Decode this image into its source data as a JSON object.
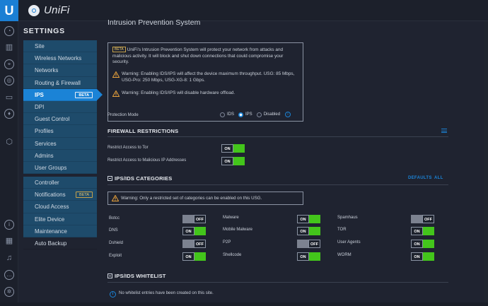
{
  "app": {
    "brand": "UniFi",
    "logo_letter": "U"
  },
  "sidebar": {
    "title": "SETTINGS",
    "group1": [
      {
        "label": "Site"
      },
      {
        "label": "Wireless Networks"
      },
      {
        "label": "Networks"
      },
      {
        "label": "Routing & Firewall"
      },
      {
        "label": "IPS",
        "active": true,
        "badge": "BETA"
      },
      {
        "label": "DPI"
      },
      {
        "label": "Guest Control"
      },
      {
        "label": "Profiles"
      },
      {
        "label": "Services"
      },
      {
        "label": "Admins"
      },
      {
        "label": "User Groups"
      }
    ],
    "group2": [
      {
        "label": "Controller"
      },
      {
        "label": "Notifications",
        "badge": "BETA"
      },
      {
        "label": "Cloud Access"
      },
      {
        "label": "Elite Device"
      },
      {
        "label": "Maintenance"
      },
      {
        "label": "Auto Backup"
      }
    ]
  },
  "page": {
    "title": "Intrusion Prevention System",
    "info": {
      "beta_badge": "BETA",
      "intro": "UniFi's Intrusion Prevention System will protect your network from attacks and malicious activity. It will block and shut down connections that could compromise your security.",
      "warning1": "Warning: Enabling IDS/IPS will affect the device maximum throughput. USG: 85 Mbps, USG-Pro: 250 Mbps, USG-XG-8: 1 Gbps.",
      "warning2": "Warning: Enabling IDS/IPS will disable hardware offload."
    },
    "protection_mode": {
      "label": "Protection Mode",
      "options": [
        "IDS",
        "IPS",
        "Disabled"
      ],
      "selected": "IPS",
      "help": "i"
    },
    "firewall": {
      "heading": "FIREWALL RESTRICTIONS",
      "rows": [
        {
          "label": "Restrict Access to Tor",
          "state": "ON"
        },
        {
          "label": "Restrict Access to Malicious IP Addresses",
          "state": "ON"
        }
      ]
    },
    "categories": {
      "heading": "IPS/IDS CATEGORIES",
      "defaults_link": "DEFAULTS",
      "all_link": "ALL",
      "warning": "Warning: Only a restricted set of categories can be enabled on this USG.",
      "col1": [
        {
          "label": "Botcc",
          "state": "OFF"
        },
        {
          "label": "DNS",
          "state": "ON"
        },
        {
          "label": "Dshield",
          "state": "OFF"
        },
        {
          "label": "Exploit",
          "state": "ON"
        }
      ],
      "col2": [
        {
          "label": "Malware",
          "state": "ON"
        },
        {
          "label": "Mobile Malware",
          "state": "ON"
        },
        {
          "label": "P2P",
          "state": "OFF"
        },
        {
          "label": "Shellcode",
          "state": "ON"
        }
      ],
      "col3": [
        {
          "label": "Spamhaus",
          "state": "OFF"
        },
        {
          "label": "TOR",
          "state": "ON"
        },
        {
          "label": "User Agents",
          "state": "ON"
        },
        {
          "label": "WORM",
          "state": "ON"
        }
      ]
    },
    "whitelist": {
      "heading": "IPS/IDS WHITELIST",
      "empty_text": "No whitelist entries have been created on this site.",
      "info": "i"
    }
  },
  "colors": {
    "accent": "#1b83d6",
    "on": "#43c51b",
    "sidebar": "#1e4b6b",
    "background": "#1f2330"
  }
}
